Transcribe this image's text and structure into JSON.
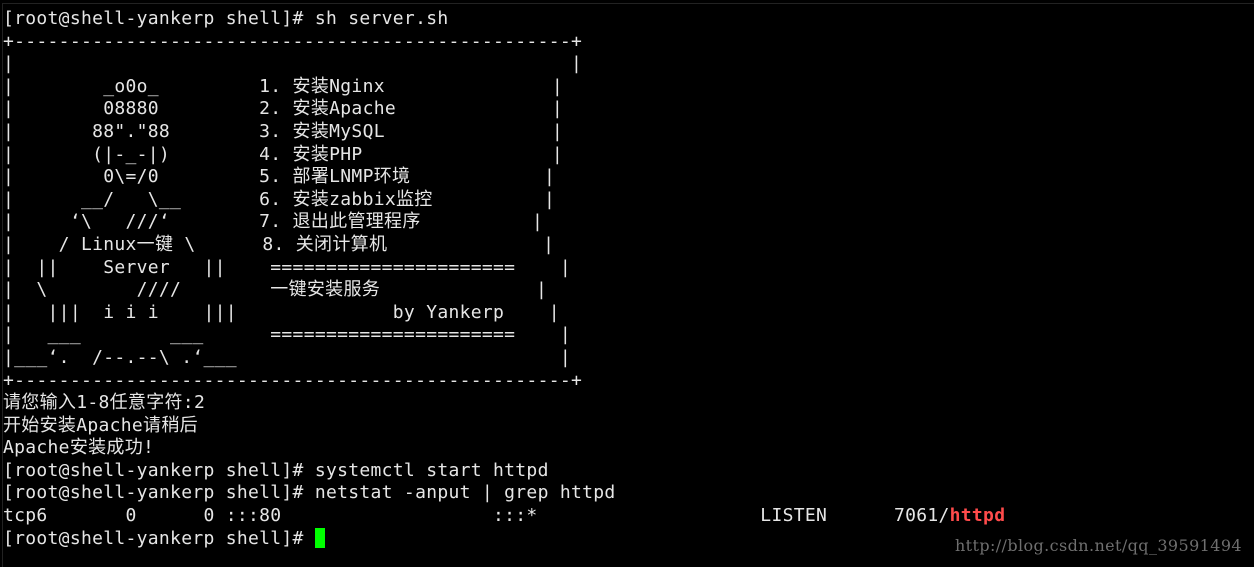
{
  "terminal": {
    "lines": [
      "[root@shell-yankerp shell]# sh server.sh",
      "+--------------------------------------------------+",
      "|                                                  |",
      "|        _o0o_         1. 安装Nginx               |",
      "|        08880         2. 安装Apache              |",
      "|       88\".\"88        3. 安装MySQL               |",
      "|       (|-_-|)        4. 安装PHP                 |",
      "|        0\\=/0         5. 部署LNMP环境            |",
      "|      __/   \\__       6. 安装zabbix监控          |",
      "|     ‘\\   ///‘        7. 退出此管理程序          |",
      "|    / Linux一键 \\      8. 关闭计算机              |",
      "|  ||    Server   ||    ======================    |",
      "|  \\        ////        一键安装服务              |",
      "|   |||  i i i    |||              by Yankerp    |",
      "|   ___        ___      ======================    |",
      "|___‘.  /--.--\\ .‘___                             |",
      "+--------------------------------------------------+",
      "请您输入1-8任意字符:2",
      "开始安装Apache请稍后",
      "Apache安装成功!",
      "[root@shell-yankerp shell]# systemctl start httpd",
      "[root@shell-yankerp shell]# netstat -anput | grep httpd"
    ],
    "netstat_row": {
      "prefix": "tcp6       0      0 :::80                   :::*                    LISTEN      7061/",
      "process": "httpd"
    },
    "final_prompt": "[root@shell-yankerp shell]# "
  },
  "watermark": "http://blog.csdn.net/qq_39591494",
  "colors": {
    "background": "#000000",
    "text": "#e6e6e6",
    "process_highlight": "#ff4b4b",
    "cursor": "#00ff00",
    "watermark": "#6f6f6f"
  }
}
